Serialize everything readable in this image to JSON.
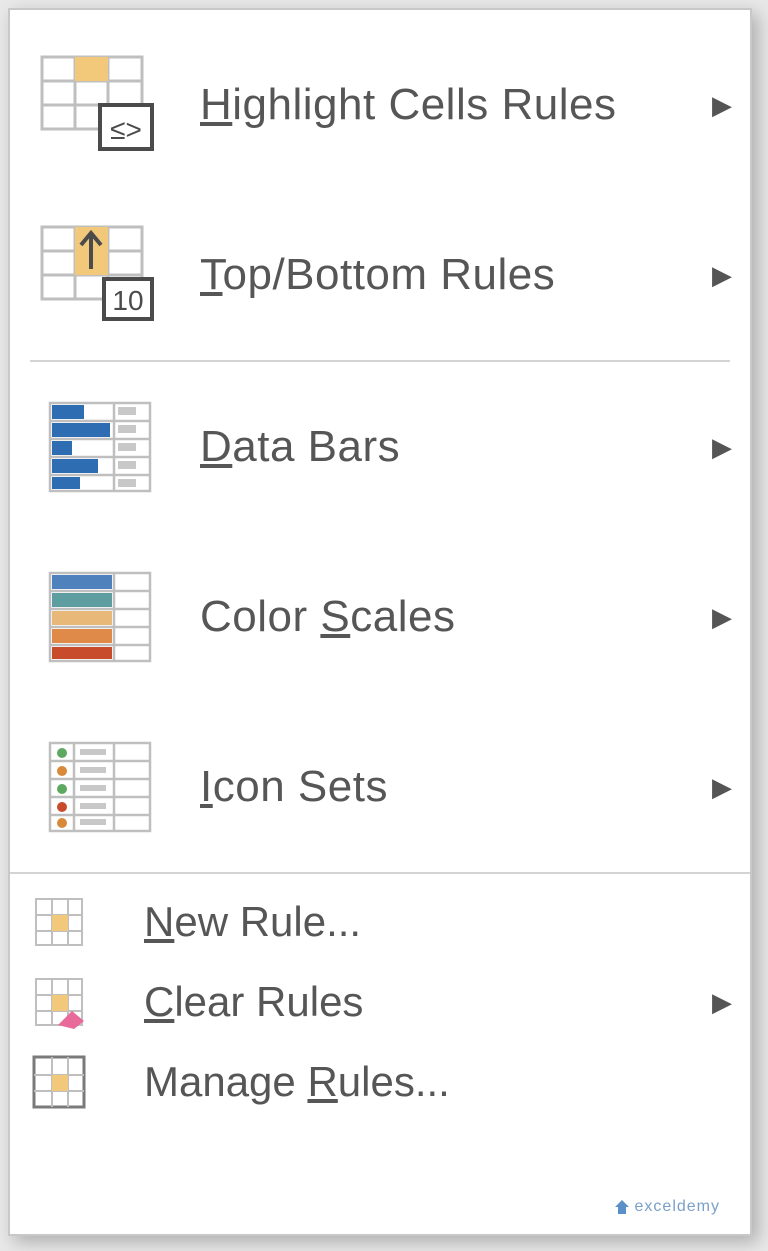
{
  "menu": {
    "groups": [
      {
        "items": [
          {
            "id": "highlight-cells-rules",
            "label_pre": "H",
            "label_post": "ighlight Cells Rules",
            "has_submenu": true
          },
          {
            "id": "top-bottom-rules",
            "label_pre": "T",
            "label_post": "op/Bottom Rules",
            "has_submenu": true
          }
        ]
      },
      {
        "items": [
          {
            "id": "data-bars",
            "label_pre": "D",
            "label_post": "ata Bars",
            "has_submenu": true
          },
          {
            "id": "color-scales",
            "prefix": "Color ",
            "label_pre": "S",
            "label_post": "cales",
            "has_submenu": true
          },
          {
            "id": "icon-sets",
            "label_pre": "I",
            "label_post": "con Sets",
            "has_submenu": true
          }
        ]
      }
    ],
    "footer": [
      {
        "id": "new-rule",
        "label_pre": "N",
        "label_post": "ew Rule...",
        "has_submenu": false
      },
      {
        "id": "clear-rules",
        "label_pre": "C",
        "label_post": "lear Rules",
        "has_submenu": true
      },
      {
        "id": "manage-rules",
        "prefix": "Manage ",
        "label_pre": "R",
        "label_post": "ules...",
        "has_submenu": false
      }
    ]
  },
  "watermark": "exceldemy"
}
